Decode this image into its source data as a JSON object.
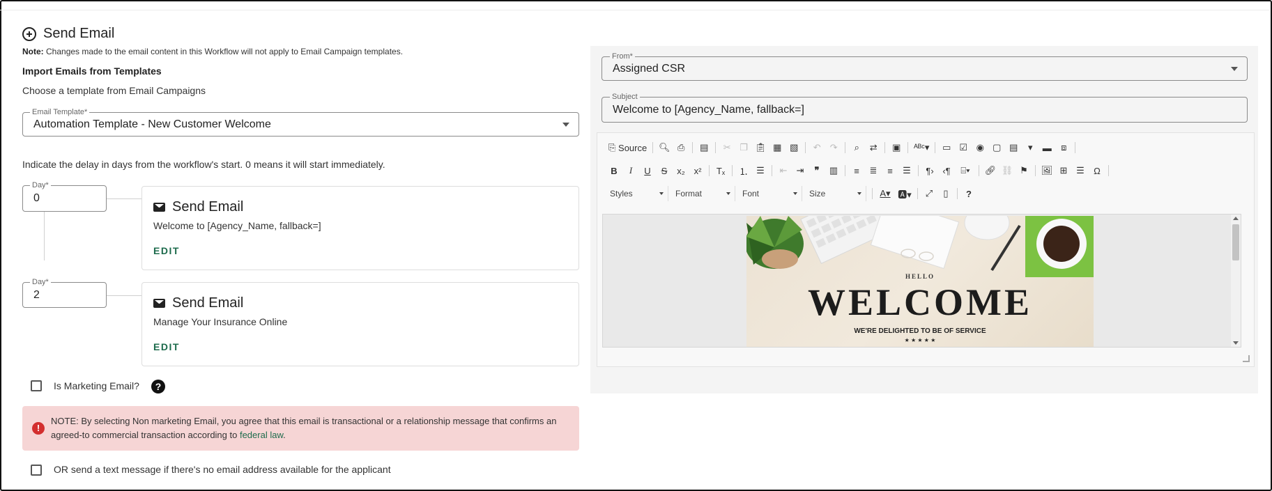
{
  "header": {
    "title": "Send Email",
    "note_prefix": "Note:",
    "note_text": " Changes made to the email content in this Workflow will not apply to Email Campaign templates."
  },
  "import": {
    "heading": "Import Emails from Templates",
    "subtext": "Choose a template from Email Campaigns",
    "template_label": "Email Template*",
    "template_value": "Automation Template - New Customer Welcome"
  },
  "delay_text": "Indicate the delay in days from the workflow's start. 0 means it will start immediately.",
  "steps": [
    {
      "day_label": "Day*",
      "day_value": "0",
      "title": "Send Email",
      "subject": "Welcome to [Agency_Name, fallback=]",
      "edit": "EDIT"
    },
    {
      "day_label": "Day*",
      "day_value": "2",
      "title": "Send Email",
      "subject": "Manage Your Insurance Online",
      "edit": "EDIT"
    }
  ],
  "marketing": {
    "label": "Is Marketing Email?",
    "checked": false,
    "help_icon": "question-icon"
  },
  "alert": {
    "text": "NOTE: By selecting Non marketing Email, you agree that this email is transactional or a relationship message that confirms an agreed-to commercial transaction according to ",
    "link": "federal law",
    "end": "."
  },
  "sms_option": {
    "label": "OR send a text message if there's no email address available for the applicant",
    "checked": false
  },
  "editor": {
    "from_label": "From*",
    "from_value": "Assigned CSR",
    "subject_label": "Subject",
    "subject_value": "Welcome to [Agency_Name, fallback=]",
    "toolbar": {
      "source": "Source",
      "styles": "Styles",
      "format": "Format",
      "font": "Font",
      "size": "Size"
    },
    "banner": {
      "hello": "HELLO",
      "welcome": "WELCOME",
      "tagline": "WE'RE DELIGHTED TO BE OF SERVICE",
      "stars": "★ ★ ★ ★ ★"
    }
  },
  "colors": {
    "accent": "#1d6b4c",
    "alert_bg": "#f6d5d5",
    "alert_icon": "#d32f2f"
  }
}
